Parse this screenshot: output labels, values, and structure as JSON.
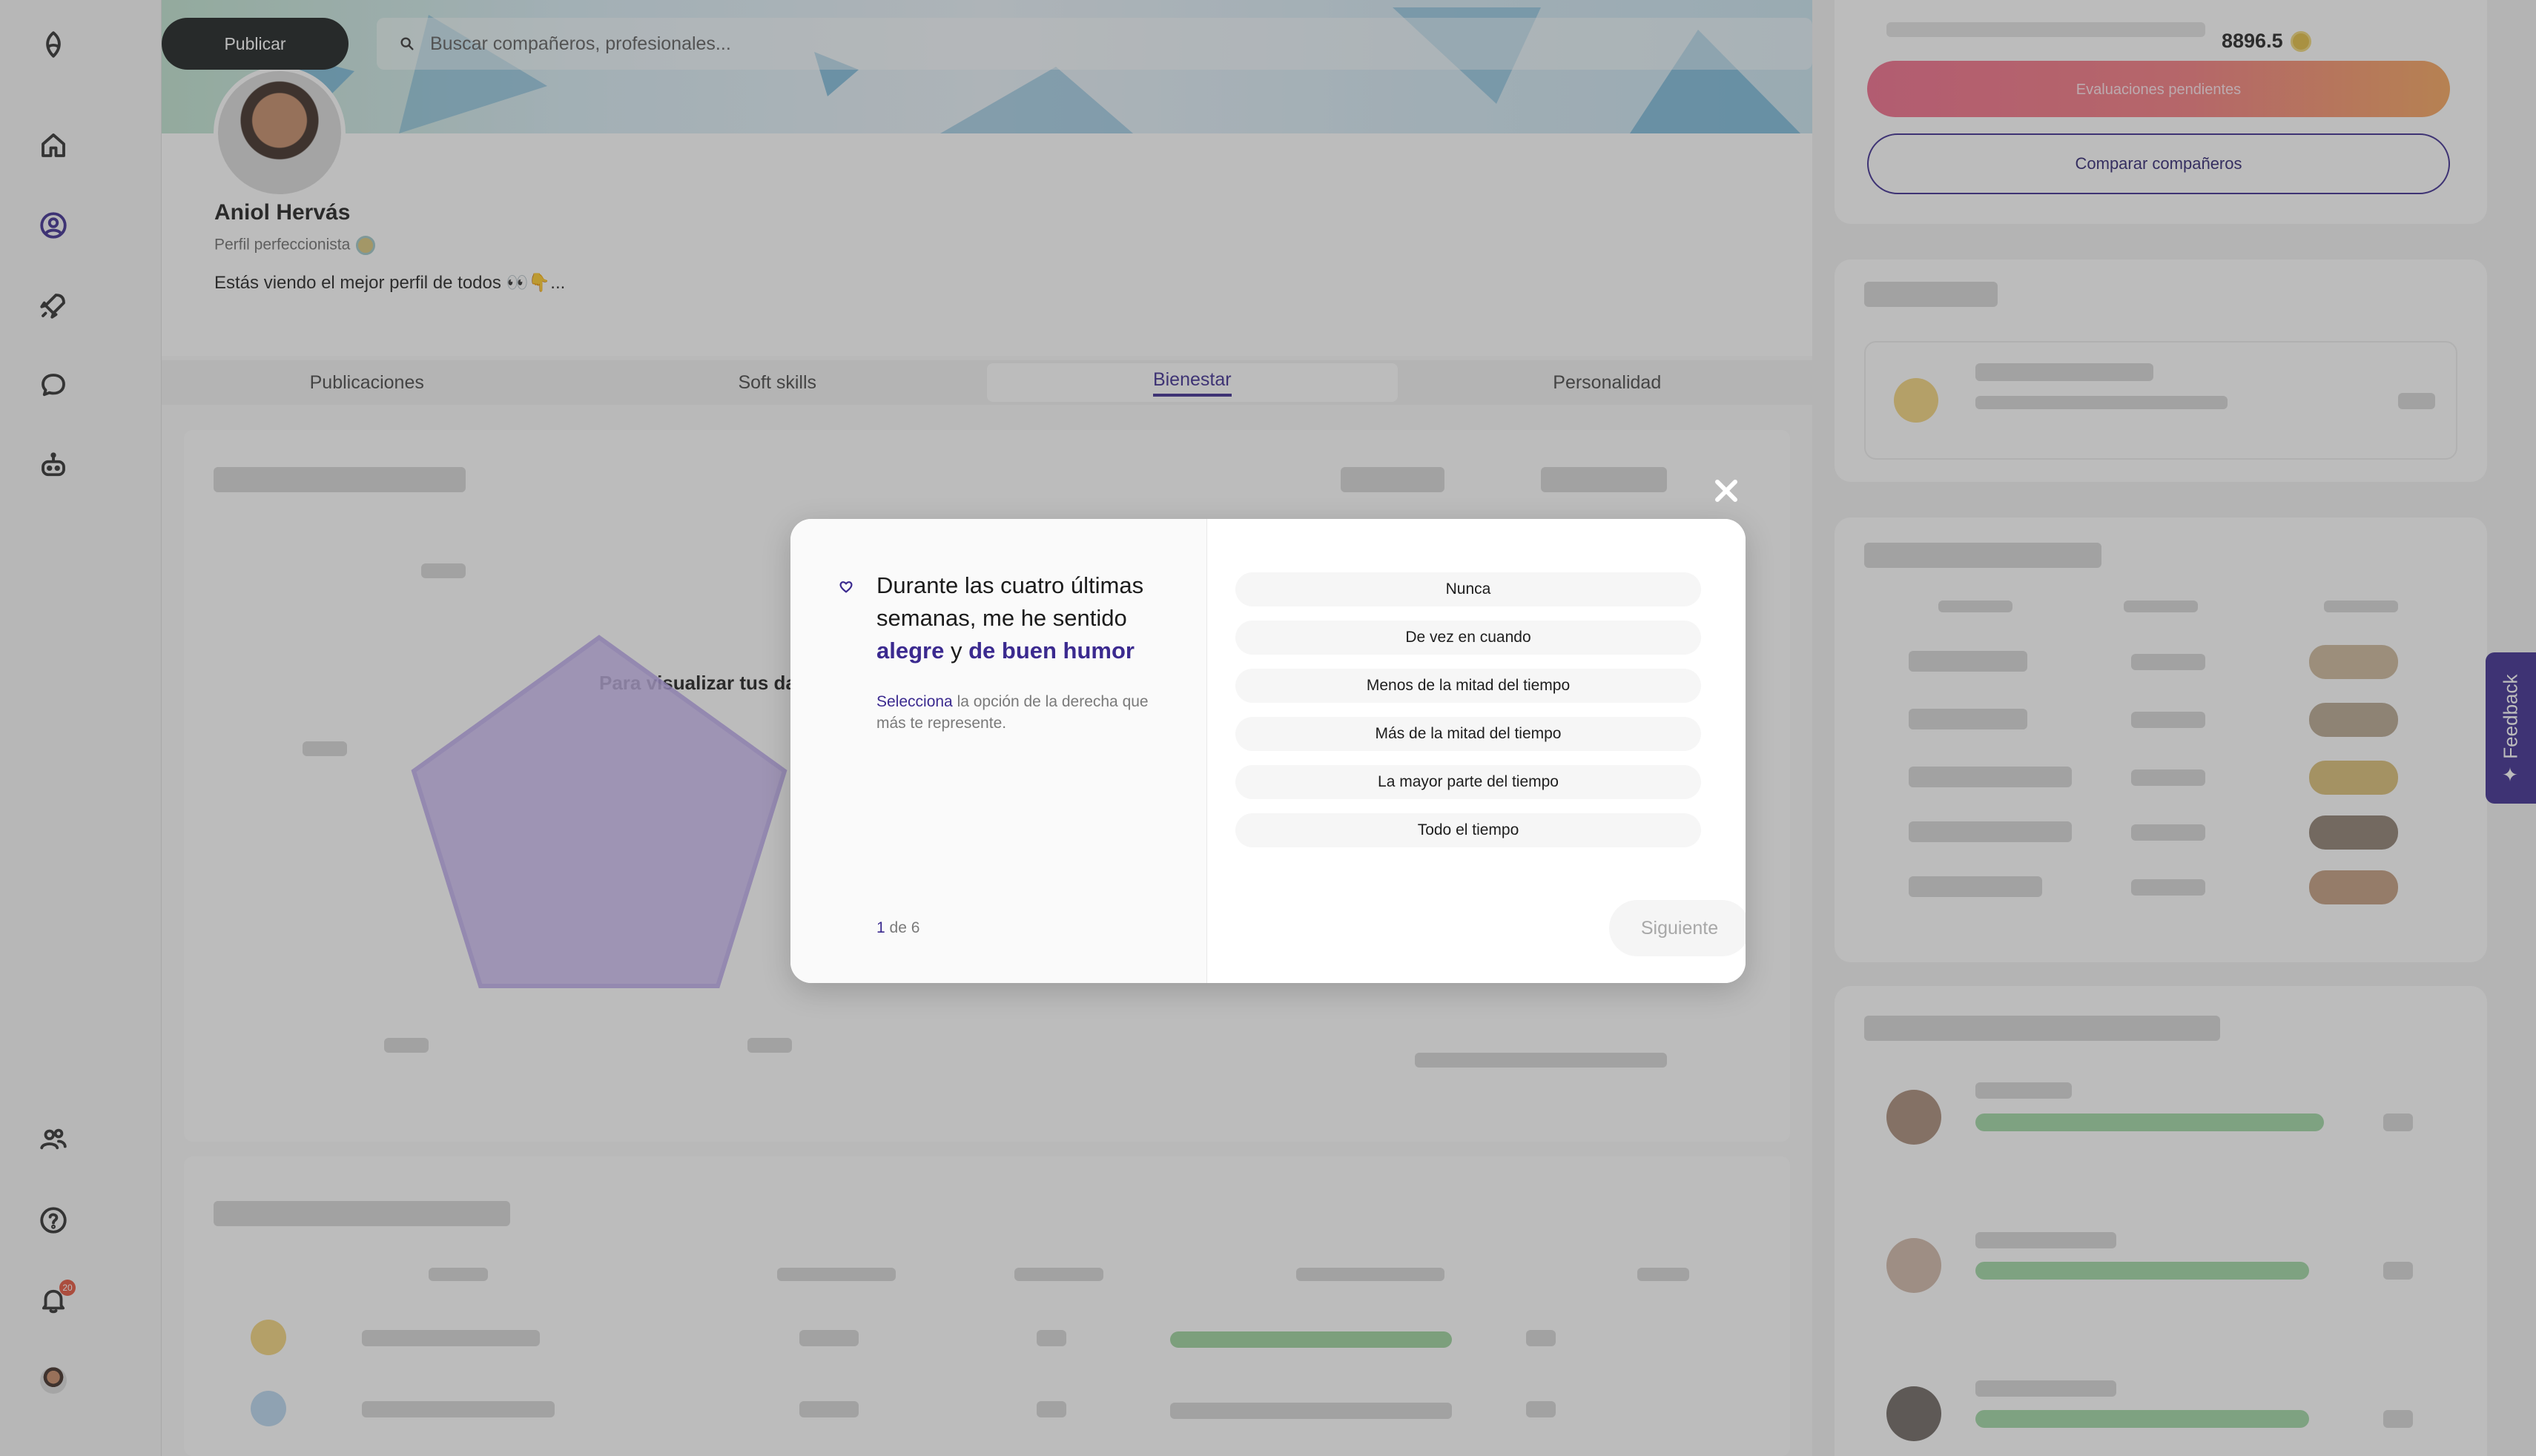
{
  "header": {
    "publish_label": "Publicar",
    "search_placeholder": "Buscar compañeros, profesionales..."
  },
  "profile": {
    "name": "Aniol Hervás",
    "subtitle": "Perfil perfeccionista",
    "bio": "Estás viendo el mejor perfil de todos 👀👇..."
  },
  "tabs": [
    {
      "label": "Publicaciones"
    },
    {
      "label": "Soft skills"
    },
    {
      "label": "Bienestar",
      "active": true
    },
    {
      "label": "Personalidad"
    }
  ],
  "background_chart_caption": "Para visualizar tus da",
  "right": {
    "balance": "8896.5",
    "eval_button": "Evaluaciones pendientes",
    "compare_button": "Comparar compañeros",
    "feedback_label": "Feedback"
  },
  "notifications": {
    "count": "20"
  },
  "modal": {
    "question_prefix": "Durante las cuatro últimas semanas, me he sentido",
    "question_em1": "alegre",
    "question_join": "y",
    "question_em2": "de buen humor",
    "hint_lead": "Selecciona",
    "hint_rest": "la opción de la derecha que más te represente.",
    "step_current": "1",
    "step_rest": "de 6",
    "options": [
      "Nunca",
      "De vez en cuando",
      "Menos de la mitad del tiempo",
      "Más de la mitad del tiempo",
      "La mayor parte del tiempo",
      "Todo el tiempo"
    ],
    "next_label": "Siguiente"
  },
  "colors": {
    "accent": "#3b2a8f",
    "publish_bg": "#171c1c",
    "eval_gradient_start": "#f06a8a",
    "eval_gradient_end": "#f6a45a"
  },
  "icons": [
    "logo-icon",
    "home-icon",
    "profile-icon",
    "rocket-icon",
    "chat-icon",
    "bot-icon",
    "people-icon",
    "help-icon",
    "bell-icon",
    "search-icon",
    "close-icon",
    "heart-icon",
    "sparkle-icon"
  ]
}
